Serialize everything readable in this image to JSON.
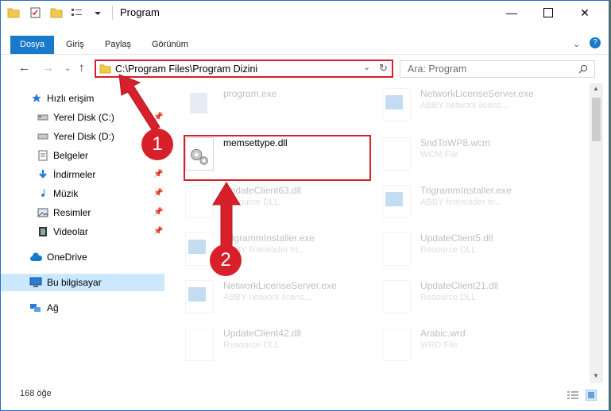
{
  "window": {
    "title": "Program"
  },
  "ribbon": {
    "tabs": [
      "Dosya",
      "Giriş",
      "Paylaş",
      "Görünüm"
    ]
  },
  "address": {
    "path": "C:\\Program Files\\Program Dizini"
  },
  "search": {
    "placeholder": "Ara: Program"
  },
  "sidebar": {
    "items": [
      {
        "label": "Hızlı erişim",
        "icon": "star-icon"
      },
      {
        "label": "Yerel Disk (C:)",
        "icon": "drive-icon",
        "pinned": true
      },
      {
        "label": "Yerel Disk (D:)",
        "icon": "drive-icon"
      },
      {
        "label": "Belgeler",
        "icon": "document-icon"
      },
      {
        "label": "İndirmeler",
        "icon": "download-icon",
        "pinned": true
      },
      {
        "label": "Müzik",
        "icon": "music-icon",
        "pinned": true
      },
      {
        "label": "Resimler",
        "icon": "pictures-icon",
        "pinned": true
      },
      {
        "label": "Videolar",
        "icon": "video-icon",
        "pinned": true
      },
      {
        "label": "OneDrive",
        "icon": "cloud-icon"
      },
      {
        "label": "Bu bilgisayar",
        "icon": "computer-icon",
        "selected": true
      },
      {
        "label": "Ağ",
        "icon": "network-icon"
      }
    ]
  },
  "files": [
    {
      "name": "program.exe",
      "sub": "",
      "type": "exe"
    },
    {
      "name": "NetworkLicenseServer.exe",
      "sub": "ABBY network licens...",
      "type": "exe"
    },
    {
      "name": "memsettype.dll",
      "sub": "",
      "type": "dll",
      "highlighted": true
    },
    {
      "name": "SndToWP8.wcm",
      "sub": "WCM File",
      "type": "doc"
    },
    {
      "name": "UpdateClient63.dll",
      "sub": "Resource DLL",
      "type": "dll"
    },
    {
      "name": "TrigrammInstaller.exe",
      "sub": "ABBY finereader tri...",
      "type": "exe"
    },
    {
      "name": "TrigrammInstaller.exe",
      "sub": "ABBY finereader tri...",
      "type": "exe"
    },
    {
      "name": "UpdateClient5.dll",
      "sub": "Resource DLL",
      "type": "dll"
    },
    {
      "name": "NetworkLicenseServer.exe",
      "sub": "ABBY network licens...",
      "type": "exe"
    },
    {
      "name": "UpdateClient21.dll",
      "sub": "Resource DLL",
      "type": "dll"
    },
    {
      "name": "UpdateClient42.dll",
      "sub": "Resource DLL",
      "type": "dll"
    },
    {
      "name": "Arabic.wrd",
      "sub": "WRD File",
      "type": "doc"
    }
  ],
  "status": {
    "count": "168 öğe"
  },
  "annotations": {
    "badge1": "1",
    "badge2": "2"
  },
  "colors": {
    "accent": "#1979ca",
    "highlight": "#d8202a",
    "selected": "#cce8ff"
  }
}
